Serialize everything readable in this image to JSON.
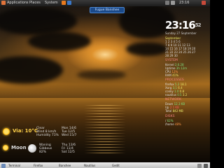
{
  "topbar": {
    "items": [
      "Applications",
      "Places",
      "System"
    ],
    "right_time": "23:16"
  },
  "toolbar_label": "Fugue Banshee",
  "clock": {
    "time": "23:16",
    "seconds": "52"
  },
  "date_line": "Sunday 27 September",
  "calendar": {
    "header": "September",
    "rows": [
      "1 2 3 4 5 6",
      "7 8 9 10 11 12 13",
      "14 15 16 17 18 19 20",
      "21 22 23 24 25 26 27",
      "28 29 30"
    ]
  },
  "system": {
    "label": "SYSTEM",
    "rows": [
      {
        "k": "Kernel",
        "v": "2.6.28"
      },
      {
        "k": "Uptime",
        "v": "3h 12m"
      },
      {
        "k": "CPU",
        "v": "12%"
      },
      {
        "k": "RAM",
        "v": "41%"
      }
    ]
  },
  "processes": {
    "label": "PROCESSES",
    "rows": [
      {
        "name": "firefox",
        "cpu": "5.2",
        "mem": "18.1"
      },
      {
        "name": "Xorg",
        "cpu": "3.1",
        "mem": "6.4"
      },
      {
        "name": "conky",
        "cpu": "1.0",
        "mem": "0.8"
      },
      {
        "name": "nautilus",
        "cpu": "0.5",
        "mem": "3.2"
      }
    ]
  },
  "network": {
    "label": "NETWORK",
    "rows": [
      {
        "k": "Down",
        "v": "12.3 KB"
      },
      {
        "k": "Up",
        "v": "2.1 KB"
      },
      {
        "k": "Total",
        "v": "842 MB"
      }
    ]
  },
  "disks": {
    "label": "DISKS",
    "rows": [
      {
        "k": "/",
        "v": "62%"
      },
      {
        "k": "/home",
        "v": "48%"
      }
    ]
  },
  "weather": {
    "temp": "Via: 10°C",
    "today_lines": [
      "Clear",
      "Wind 8 km/h",
      "Humidity 71%"
    ],
    "forecast_lines": [
      "Mon 14/6",
      "Tue 12/5",
      "Wed 15/7"
    ],
    "moon_temp": "Moon",
    "moon_lines": [
      "Waning",
      "Gibbous",
      "82%"
    ],
    "forecast2_lines": [
      "Thu 13/6",
      "Fri 11/4",
      "Sat 12/5"
    ]
  },
  "taskbar": {
    "items": [
      "Terminal",
      "Firefox",
      "Banshee",
      "Nautilus",
      "Gedit"
    ]
  }
}
